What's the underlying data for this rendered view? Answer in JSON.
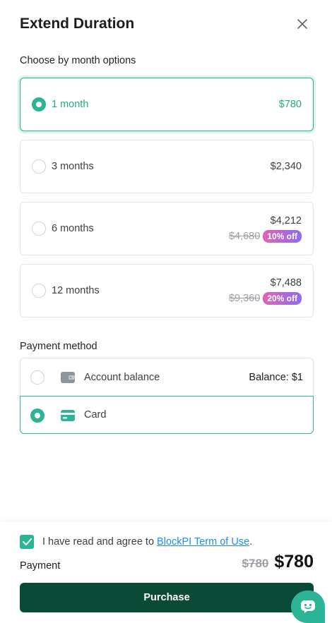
{
  "header": {
    "title": "Extend Duration"
  },
  "duration": {
    "section_label": "Choose by month options",
    "options": [
      {
        "label": "1 month",
        "price": "$780",
        "selected": true
      },
      {
        "label": "3 months",
        "price": "$2,340",
        "selected": false
      },
      {
        "label": "6 months",
        "price": "$4,212",
        "original_price": "$4,680",
        "discount": "10% off",
        "selected": false
      },
      {
        "label": "12 months",
        "price": "$7,488",
        "original_price": "$9,360",
        "discount": "20% off",
        "selected": false
      }
    ]
  },
  "payment_method": {
    "section_label": "Payment method",
    "account": {
      "label": "Account balance",
      "balance": "Balance: $1",
      "icon": "wallet-icon",
      "selected": false
    },
    "card": {
      "label": "Card",
      "icon": "credit-card-icon",
      "selected": true
    }
  },
  "footer": {
    "agree_text": "I have read and agree to ",
    "terms_link": "BlockPI Term of Use",
    "agree_suffix": ".",
    "agreed": true,
    "payment_label": "Payment",
    "old_price": "$780",
    "new_price": "$780",
    "purchase_label": "Purchase"
  },
  "colors": {
    "accent": "#2bb596",
    "primary_button": "#0c4a38",
    "link": "#1a8cff"
  }
}
